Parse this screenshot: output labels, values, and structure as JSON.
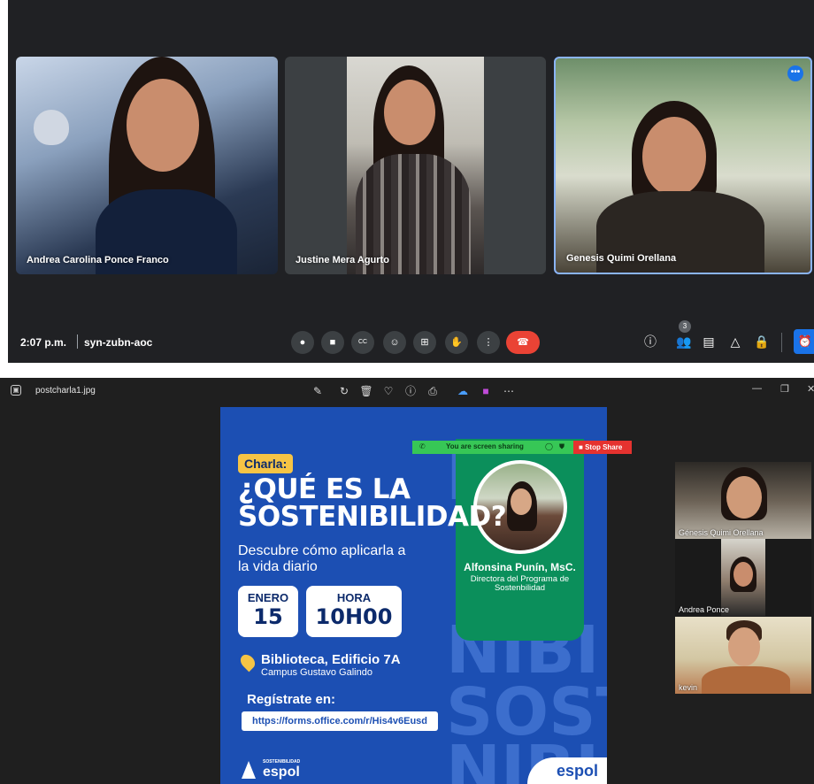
{
  "meeting": {
    "participants": [
      {
        "name": "Andrea Carolina Ponce Franco"
      },
      {
        "name": "Justine Mera Agurto"
      },
      {
        "name": "Genesis Quimi Orellana"
      }
    ],
    "time": "2:07 p.m.",
    "meeting_code": "syn-zubn-aoc",
    "people_count": "3",
    "controls": {
      "mic": "mic-icon",
      "camera": "camera-icon",
      "captions": "CC",
      "emoji": "emoji-icon",
      "present": "present-icon",
      "raise_hand": "hand-icon",
      "more": "more-vert-icon",
      "end_call": "end-call-icon"
    },
    "colors": {
      "background": "#202124",
      "accent": "#1a73e8",
      "end_call": "#ea4335",
      "active_tile_border": "#8ab4f8"
    }
  },
  "viewer": {
    "filename": "postcharla1.jpg",
    "poster": {
      "tag": "Charla:",
      "headline_l1": "¿QUÉ ES LA",
      "headline_l2": "SOSTENIBILIDAD?",
      "subtitle": "Descubre cómo aplicarla a la vida diario",
      "month": "ENERO",
      "day": "15",
      "hour_label": "HORA",
      "hour": "10H00",
      "location": "Biblioteca, Edificio 7A",
      "campus": "Campus Gustavo Galindo",
      "register_label": "Regístrate en:",
      "url": "https://forms.office.com/r/His4v6Eusd",
      "speaker_name": "Alfonsina Punín, MsC.",
      "speaker_role": "Directora del Programa de Sostenbilidad",
      "logo_small": "SOSTENIBILIDAD",
      "logo_brand": "espol",
      "corner_brand": "espol",
      "watermark": [
        "N",
        "NIBI",
        "SOST",
        "NIBI"
      ],
      "colors": {
        "blue": "#1c4fb3",
        "green": "#0b8f5b",
        "yellow": "#f6c445"
      }
    },
    "share_bar": {
      "text": "You are screen sharing",
      "stop_label": "Stop Share"
    },
    "thumbnails": [
      {
        "name": "Génesis Quimi Orellana"
      },
      {
        "name": "Andrea Ponce"
      },
      {
        "name": "kevin"
      }
    ]
  }
}
